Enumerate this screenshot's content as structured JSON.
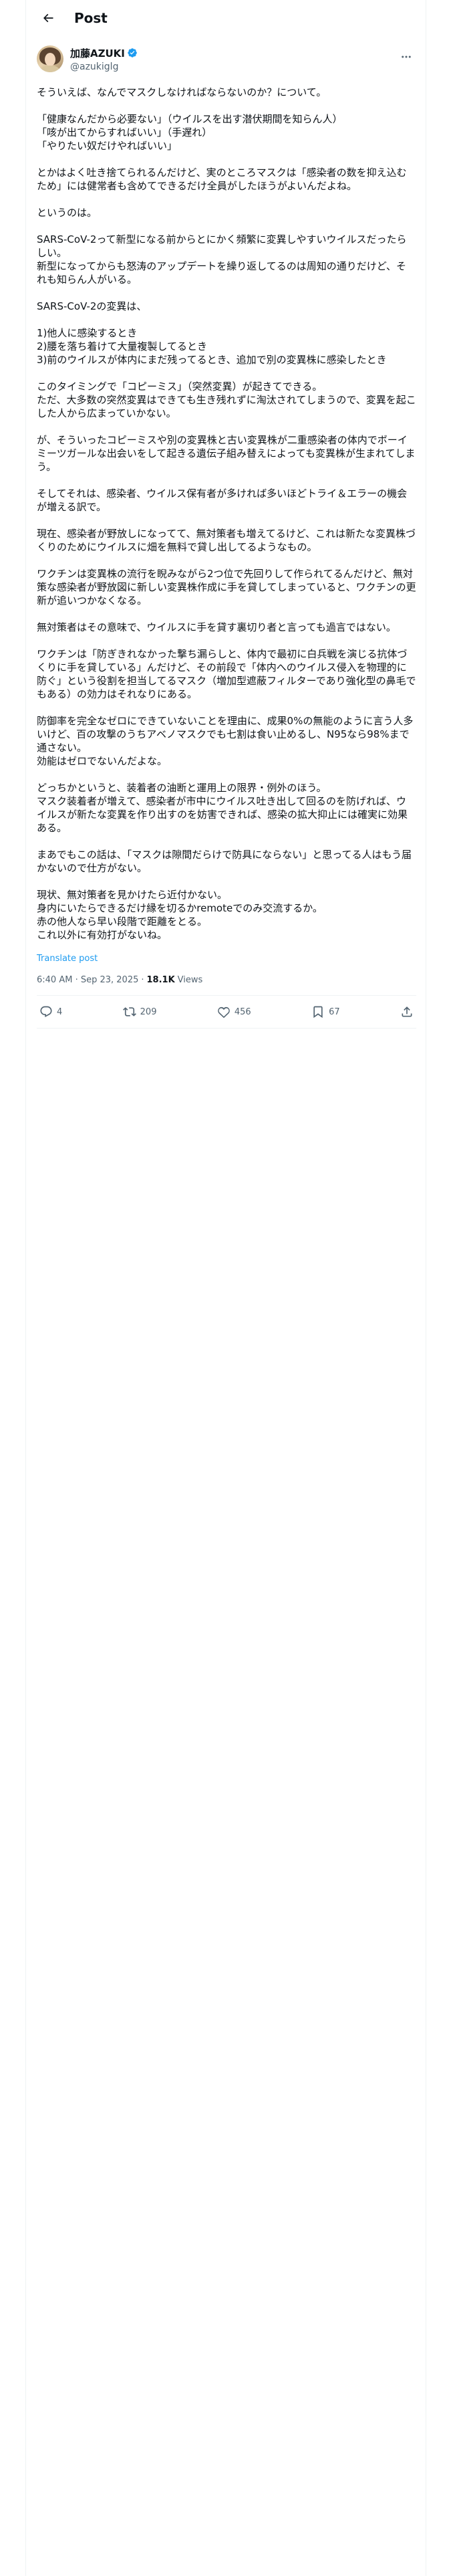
{
  "header": {
    "title": "Post"
  },
  "author": {
    "name": "加藤AZUKI",
    "handle": "@azukiglg"
  },
  "post": {
    "text": "そういえば、なんでマスクしなければならないのか？について。\n\n「健康なんだから必要ない」（ウイルスを出す潜伏期間を知らん人）\n「咳が出てからすればいい」（手遅れ）\n「やりたい奴だけやればいい」\n\nとかはよく吐き捨てられるんだけど、実のところマスクは「感染者の数を抑え込むため」には健常者も含めてできるだけ全員がしたほうがよいんだよね。\n\nというのは。\n\nSARS-CoV-2って新型になる前からとにかく頻繁に変異しやすいウイルスだったらしい。\n新型になってからも怒涛のアップデートを繰り返してるのは周知の通りだけど、それも知らん人がいる。\n\nSARS-CoV-2の変異は、\n\n1)他人に感染するとき\n2)腰を落ち着けて大量複製してるとき\n3)前のウイルスが体内にまだ残ってるとき、追加で別の変異株に感染したとき\n\nこのタイミングで「コピーミス」（突然変異）が起きてできる。\nただ、大多数の突然変異はできても生き残れずに淘汰されてしまうので、変異を起こした人から広まっていかない。\n\nが、そういったコピーミスや別の変異株と古い変異株が二重感染者の体内でボーイミーツガールな出会いをして起きる遺伝子組み替えによっても変異株が生まれてしまう。\n\nそしてそれは、感染者、ウイルス保有者が多ければ多いほどトライ＆エラーの機会が増える訳で。\n\n現在、感染者が野放しになってて、無対策者も増えてるけど、これは新たな変異株づくりのためにウイルスに畑を無料で貸し出してるようなもの。\n\nワクチンは変異株の流行を睨みながら2つ位で先回りして作られてるんだけど、無対策な感染者が野放図に新しい変異株作成に手を貸してしまっていると、ワクチンの更新が追いつかなくなる。\n\n無対策者はその意味で、ウイルスに手を貸す裏切り者と言っても過言ではない。\n\nワクチンは「防ぎきれなかった撃ち漏らしと、体内で最初に白兵戦を演じる抗体づくりに手を貸している」んだけど、その前段で「体内へのウイルス侵入を物理的に防ぐ」という役割を担当してるマスク（増加型遮蔽フィルターであり強化型の鼻毛でもある）の効力はそれなりにある。\n\n防御率を完全なゼロにできていないことを理由に、成果0%の無能のように言う人多いけど、百の攻撃のうちアベノマスクでも七割は食い止めるし、N95なら98%まで通さない。\n効能はゼロでないんだよな。\n\nどっちかというと、装着者の油断と運用上の限界・例外のほう。\nマスク装着者が増えて、感染者が市中にウイルス吐き出して回るのを防げれば、ウイルスが新たな変異を作り出すのを妨害できれば、感染の拡大抑止には確実に効果ある。\n\nまあでもこの話は、「マスクは隙間だらけで防具にならない」と思ってる人はもう届かないので仕方がない。\n\n現状、無対策者を見かけたら近付かない。\n身内にいたらできるだけ縁を切るかremoteでのみ交流するか。\n赤の他人なら早い段階で距離をとる。\nこれ以外に有効打がないね。",
    "translate_label": "Translate post",
    "time": "6:40 AM · Sep 23, 2025",
    "separator": "·",
    "views": "18.1K",
    "views_label": "Views"
  },
  "stats": {
    "replies": "4",
    "reposts": "209",
    "likes": "456",
    "bookmarks": "67"
  },
  "icons": [
    "back-arrow-icon",
    "verified-badge-icon",
    "more-icon",
    "reply-icon",
    "repost-icon",
    "like-icon",
    "bookmark-icon",
    "share-icon"
  ],
  "colors": {
    "accent": "#1d9bf0",
    "muted": "#536471",
    "text": "#0f1419",
    "border": "#eff3f4"
  }
}
